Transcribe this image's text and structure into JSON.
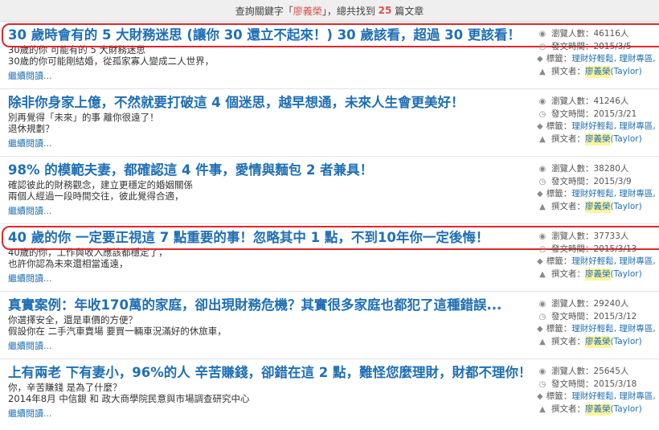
{
  "header": {
    "prefix": "查詢關鍵字「",
    "keyword": "廖義榮",
    "middle": "」，總共找到",
    "count": "25",
    "suffix": "篇文章"
  },
  "labels": {
    "views": "瀏覽人數：",
    "views_unit": " 人",
    "date": "發文時間：",
    "tags": "標籤：",
    "author": "撰文者：",
    "more": "繼續閱讀..."
  },
  "articles": [
    {
      "title": "30 歲時會有的 5 大財務迷思 (讓你 30 還立不起來！) 30 歲該看，超過 30 更該看！",
      "line1": "30歲的你 可能有的 5 大財務迷思",
      "line2": "30歲的你可能剛結婚，從孤家寡人變成二人世界，",
      "views": "46116",
      "date": "2015/3/5",
      "tags": "理財好輕鬆, 理財專區,",
      "author_hl": "廖義榮",
      "author_rest": "(Taylor)"
    },
    {
      "title": "除非你身家上億，不然就要打破這 4 個迷思，越早想通，未來人生會更美好！",
      "line1": "別再覺得「未來」的事 離你很遠了！",
      "line2": "退休規劃？",
      "views": "41246",
      "date": "2015/3/21",
      "tags": "理財好輕鬆, 理財專區,",
      "author_hl": "廖義榮",
      "author_rest": "(Taylor)"
    },
    {
      "title": "98% 的模範夫妻，都確認這 4 件事，愛情與麵包 2 者兼具！",
      "line1": "確認彼此的財務觀念，建立更穩定的婚姻關係",
      "line2": "兩個人經過一段時間交往，彼此覺得合適，",
      "views": "38280",
      "date": "2015/3/9",
      "tags": "理財好輕鬆, 理財專區,",
      "author_hl": "廖義榮",
      "author_rest": "(Taylor)"
    },
    {
      "title": "40 歲的你 一定要正視這 7 點重要的事！忽略其中 1 點，不到10年你一定後悔！",
      "line1": "40歲的你，工作與收入應該都穩定了，",
      "line2": "也許你認為未來還相當遙遠，",
      "views": "37733",
      "date": "2015/3/13",
      "tags": "理財好輕鬆, 理財專區,",
      "author_hl": "廖義榮",
      "author_rest": "(Taylor)"
    },
    {
      "title": "真實案例：年收170萬的家庭，卻出現財務危機？其實很多家庭也都犯了這種錯誤...",
      "line1": "你選擇安全，還是車價的方便？",
      "line2": "假設你在 二手汽車賣場 要買一輛車況滿好的休旅車，",
      "views": "29240",
      "date": "2015/3/12",
      "tags": "理財好輕鬆, 理財專區,",
      "author_hl": "廖義榮",
      "author_rest": "(Taylor)"
    },
    {
      "title": "上有兩老 下有妻小，96%的人 辛苦賺錢，卻錯在這 2 點，難怪您麼理財，財都不理你！",
      "line1": "你，辛苦賺錢 是為了什麼？",
      "line2": "2014年8月 中信銀 和 政大商學院民意與市場調查研究中心",
      "views": "25645",
      "date": "2015/3/18",
      "tags": "理財好輕鬆, 理財專區,",
      "author_hl": "廖義榮",
      "author_rest": "(Taylor)"
    }
  ]
}
